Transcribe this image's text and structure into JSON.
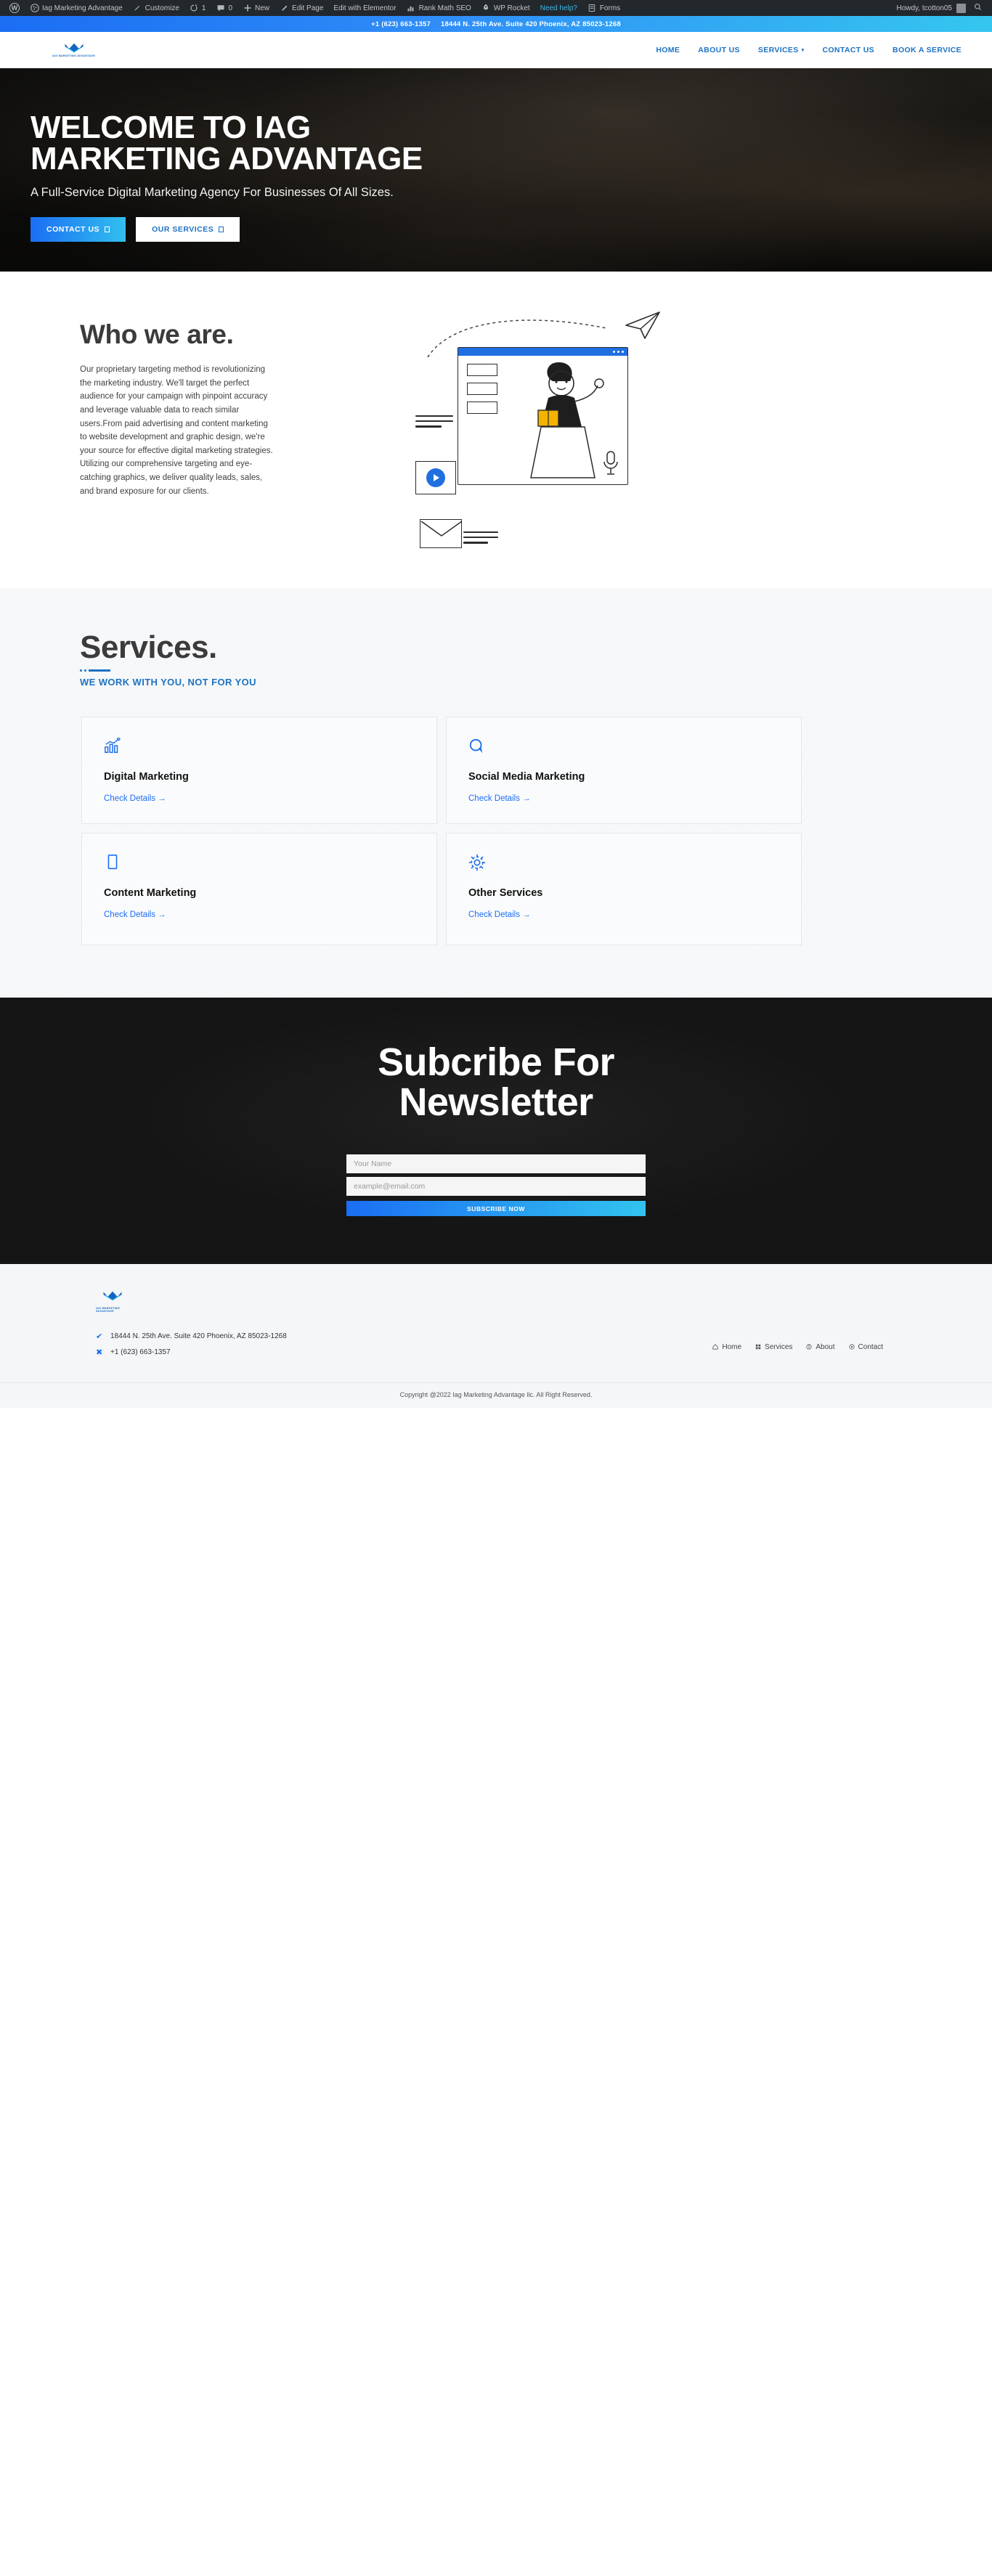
{
  "admin_bar": {
    "logo_icon": "wordpress-logo-icon",
    "items": [
      {
        "icon": "dashboard-icon",
        "label": "Iag Marketing Advantage"
      },
      {
        "icon": "brush-icon",
        "label": "Customize"
      },
      {
        "icon": "updates-icon",
        "label": "1"
      },
      {
        "icon": "comments-icon",
        "label": "0"
      },
      {
        "icon": "plus-icon",
        "label": "New"
      },
      {
        "icon": "pencil-icon",
        "label": "Edit Page"
      },
      {
        "icon": "elementor-icon",
        "label": "Edit with Elementor"
      },
      {
        "icon": "rankmath-icon",
        "label": "Rank Math SEO"
      },
      {
        "icon": "rocket-icon",
        "label": "WP Rocket"
      }
    ],
    "help_label": "Need help?",
    "forms": {
      "icon": "forms-icon",
      "label": "Forms"
    },
    "howdy": "Howdy, tcotton05",
    "search_icon": "search-icon"
  },
  "topbar": {
    "phone": "+1 (623) 663-1357",
    "address": "18444 N. 25th Ave. Suite 420 Phoenix, AZ 85023-1268",
    "gradient_from": "#1b6ef3",
    "gradient_to": "#35c6ef"
  },
  "header": {
    "logo_text": "IAG MARKETING ADVANTAGE",
    "nav": [
      {
        "label": "HOME",
        "has_caret": false
      },
      {
        "label": "ABOUT US",
        "has_caret": false
      },
      {
        "label": "SERVICES",
        "has_caret": true
      },
      {
        "label": "CONTACT US",
        "has_caret": false
      },
      {
        "label": "BOOK A SERVICE",
        "has_caret": false
      }
    ],
    "accent": "#1d72c2"
  },
  "hero": {
    "title_line1": "WELCOME TO IAG",
    "title_line2": "MARKETING ADVANTAGE",
    "subtitle": "A Full-Service Digital Marketing Agency For Businesses Of All Sizes.",
    "btn_primary": "CONTACT US",
    "btn_secondary": "OUR SERVICES"
  },
  "who": {
    "heading": "Who we are.",
    "body": "Our proprietary targeting method is revolutionizing the marketing industry. We'll target the perfect audience for your campaign with pinpoint accuracy and leverage valuable data to reach similar users.From paid advertising and content marketing to website development and graphic design, we're your source for effective digital marketing strategies. Utilizing our comprehensive targeting and eye-catching graphics, we deliver quality leads, sales, and brand exposure for our clients."
  },
  "services": {
    "heading": "Services.",
    "subheading": "WE WORK WITH YOU, NOT FOR YOU",
    "cards": [
      {
        "icon": "chart-growth-icon",
        "title": "Digital Marketing",
        "link": "Check Details →"
      },
      {
        "icon": "chat-bubble-icon",
        "title": "Social Media Marketing",
        "link": "Check Details →"
      },
      {
        "icon": "document-icon",
        "title": "Content Marketing",
        "link": "Check Details →"
      },
      {
        "icon": "gear-icon",
        "title": "Other Services",
        "link": "Check Details →"
      }
    ]
  },
  "newsletter": {
    "title_line1": "Subcribe For",
    "title_line2": "Newsletter",
    "name_placeholder": "Your Name",
    "email_placeholder": "example@email.com",
    "submit_label": "SUBSCRIBE NOW"
  },
  "footer": {
    "logo_text": "IAG MARKETING ADVANTAGE",
    "address": "18444 N. 25th Ave. Suite 420 Phoenix, AZ 85023-1268",
    "phone": "+1 (623) 663-1357",
    "links": [
      {
        "icon": "home-icon",
        "label": "Home"
      },
      {
        "icon": "services-icon",
        "label": "Services"
      },
      {
        "icon": "about-icon",
        "label": "About"
      },
      {
        "icon": "contact-icon",
        "label": "Contact"
      }
    ],
    "copyright": "Copyright @2022 Iag Marketing Advantage llc. All Right Reserved."
  }
}
